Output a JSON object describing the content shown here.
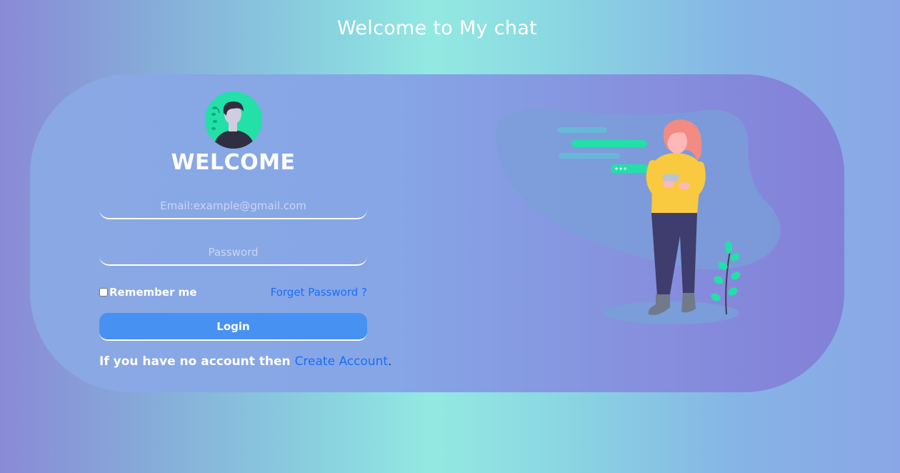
{
  "header": {
    "title": "Welcome to My chat"
  },
  "login": {
    "heading": "WELCOME",
    "email_placeholder": "Email:example@gmail.com",
    "password_placeholder": "Password",
    "remember_label": "Remember me",
    "remember_checked": false,
    "forgot_label": "Forget Password ?",
    "login_label": "Login",
    "signup_prefix": "If you have no account then ",
    "signup_link": "Create Account",
    "signup_suffix": "."
  },
  "colors": {
    "accent_green": "#22e0a8",
    "link_blue": "#1a6ef5",
    "button_blue": "#4791f2"
  },
  "icons": {
    "avatar": "user-avatar-icon",
    "illustration": "woman-chatting-on-phone-illustration"
  }
}
